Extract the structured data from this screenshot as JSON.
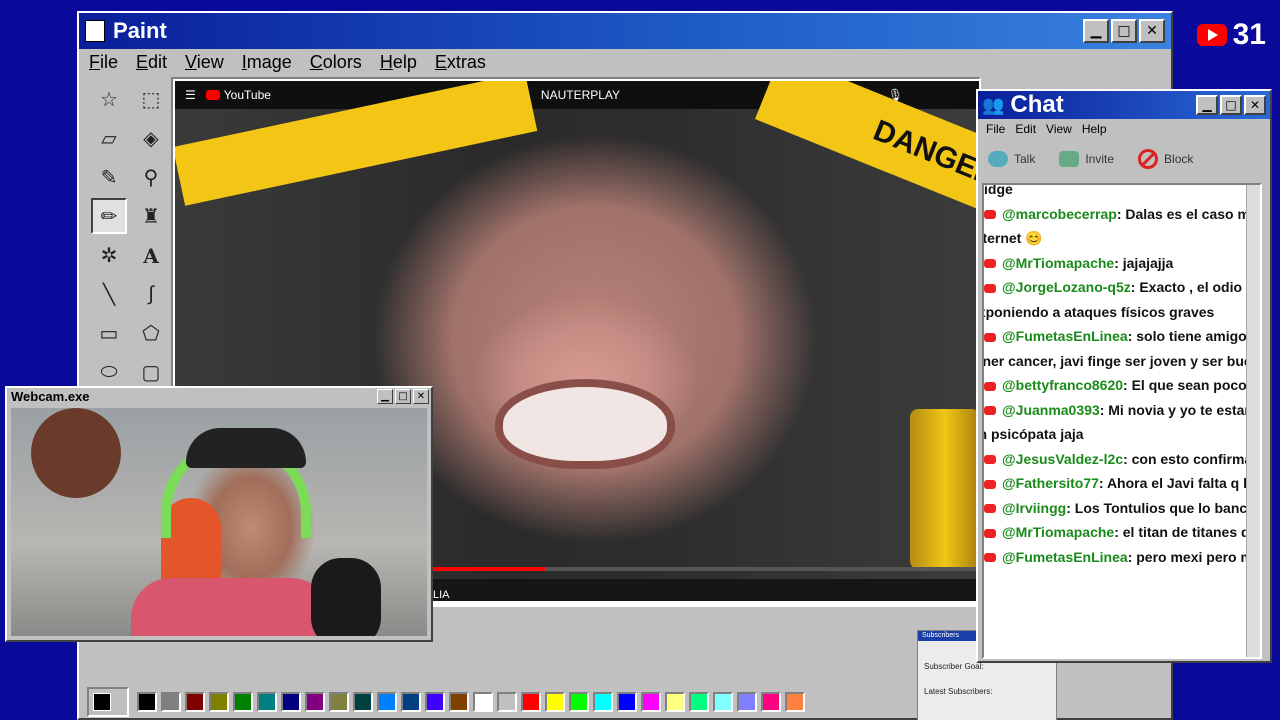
{
  "overlay": {
    "youtube_count": "31"
  },
  "paint": {
    "title": "Paint",
    "menu": [
      "File",
      "Edit",
      "View",
      "Image",
      "Colors",
      "Help",
      "Extras"
    ],
    "tools": [
      "free-select-icon",
      "rect-select-icon",
      "eraser-icon",
      "fill-icon",
      "color-picker-icon",
      "magnifier-icon",
      "pencil-icon",
      "brush-icon",
      "airbrush-icon",
      "text-icon",
      "line-icon",
      "curve-icon",
      "rectangle-icon",
      "polygon-icon",
      "ellipse-icon",
      "rounded-rect-icon"
    ],
    "palette": [
      "#000000",
      "#808080",
      "#800000",
      "#808000",
      "#008000",
      "#008080",
      "#000080",
      "#800080",
      "#808040",
      "#004040",
      "#0080ff",
      "#004080",
      "#4000ff",
      "#804000",
      "#ffffff",
      "#c0c0c0",
      "#ff0000",
      "#ffff00",
      "#00ff00",
      "#00ffff",
      "#0000ff",
      "#ff00ff",
      "#ffff80",
      "#00ff80",
      "#80ffff",
      "#8080ff",
      "#ff0080",
      "#ff8040"
    ]
  },
  "youtube": {
    "brand": "YouTube",
    "search_query": "NAUTERPLAY",
    "tape_text": "DANGER",
    "caption": "LIA",
    "progress": 0.46
  },
  "subscribers": {
    "title": "Subscribers",
    "goal": "Subscriber Goal:",
    "latest": "Latest Subscribers:"
  },
  "webcam": {
    "title": "Webcam.exe"
  },
  "chat": {
    "title": "Chat",
    "menu": [
      "File",
      "Edit",
      "View",
      "Help"
    ],
    "toolbar": {
      "talk": "Talk",
      "invite": "Invite",
      "block": "Block"
    },
    "messages": [
      {
        "user": "",
        "text": "",
        "cont": "bridge"
      },
      {
        "user": "@marcobecerrap",
        "text": ": Dalas es el caso más sev",
        "cont": "internet 😊"
      },
      {
        "user": "@MrTiomapache",
        "text": ": jajajajja",
        "cont": ""
      },
      {
        "user": "@JorgeLozano-q5z",
        "text": ": Exacto , el odio ya está",
        "cont": "exponiendo a ataques físicos graves"
      },
      {
        "user": "@FumetasEnLinea",
        "text": ": solo tiene amigos que f",
        "cont": "tener cancer, javi finge ser joven y ser buena pe"
      },
      {
        "user": "@bettyfranco8620",
        "text": ": El que sean poco comu",
        "cont": ""
      },
      {
        "user": "@Juanma0393",
        "text": ": Mi novia y yo te estamos",
        "cont": "un psicópata jaja"
      },
      {
        "user": "@JesusValdez-l2c",
        "text": ": con esto confirmamos c",
        "cont": ""
      },
      {
        "user": "@Fathersito77",
        "text": ": Ahora el Javi falta q haga un",
        "cont": ""
      },
      {
        "user": "@Irviingg",
        "text": ": Los Tontulios que lo bancaban y a",
        "cont": ""
      },
      {
        "user": "@MrTiomapache",
        "text": ": el titan de titanes diagno",
        "cont": ""
      },
      {
        "user": "@FumetasEnLinea",
        "text": ": pero mexi pero mexi pe",
        "cont": ""
      }
    ]
  }
}
